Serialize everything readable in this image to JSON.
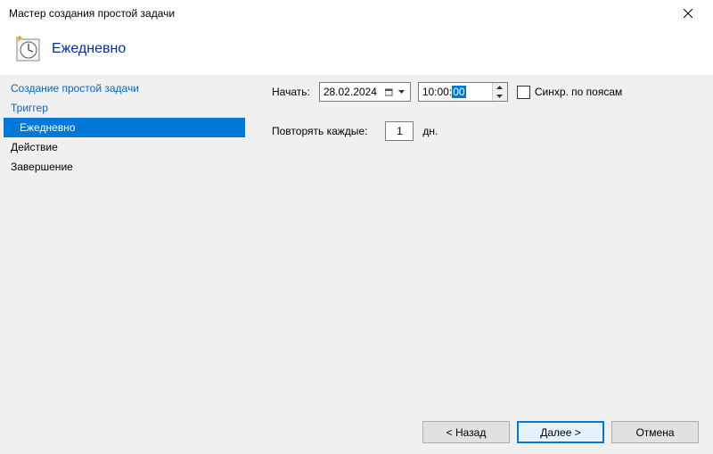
{
  "window": {
    "title": "Мастер создания простой задачи"
  },
  "header": {
    "title": "Ежедневно"
  },
  "sidebar": {
    "items": [
      {
        "label": "Создание простой задачи"
      },
      {
        "label": "Триггер"
      },
      {
        "label": "Ежедневно"
      },
      {
        "label": "Действие"
      },
      {
        "label": "Завершение"
      }
    ]
  },
  "form": {
    "start_label": "Начать:",
    "date_value": "28.02.2024",
    "time_hours_minutes": "10:00:",
    "time_seconds": "00",
    "sync_label": "Синхр. по поясам",
    "repeat_label": "Повторять каждые:",
    "repeat_value": "1",
    "days_unit": "дн."
  },
  "footer": {
    "back": "< Назад",
    "next": "Далее >",
    "cancel": "Отмена"
  }
}
